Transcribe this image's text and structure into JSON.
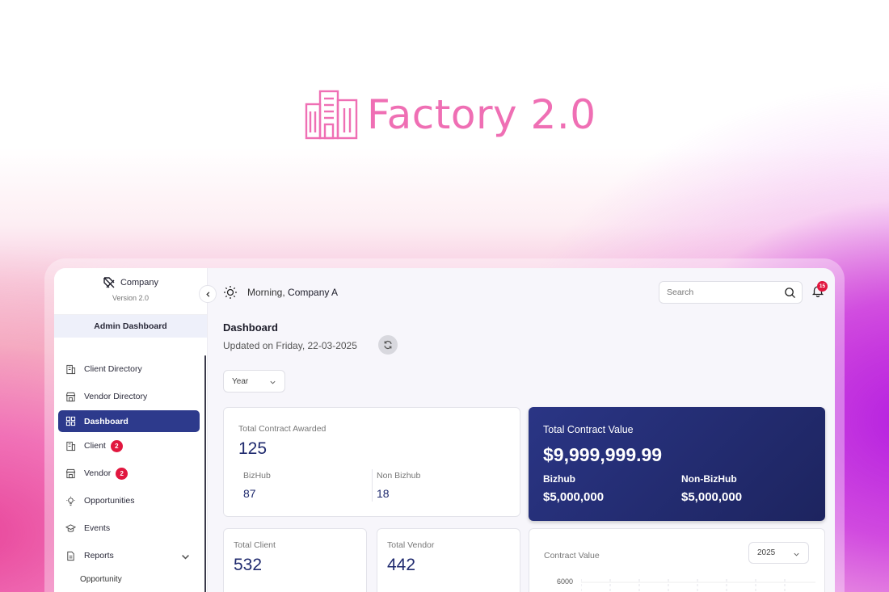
{
  "hero": {
    "title": "Factory 2.0",
    "color": "#ef6fb4"
  },
  "brand": {
    "name": "Company",
    "version": "Version 2.0"
  },
  "sidebar": {
    "section_label": "Admin Dashboard",
    "items": [
      {
        "label": "Client Directory",
        "icon": "building-icon"
      },
      {
        "label": "Vendor Directory",
        "icon": "store-icon"
      },
      {
        "label": "Dashboard",
        "icon": "grid-icon",
        "active": true
      },
      {
        "label": "Client",
        "icon": "building-icon",
        "badge": "2"
      },
      {
        "label": "Vendor",
        "icon": "store-icon",
        "badge": "2"
      },
      {
        "label": "Opportunities",
        "icon": "lightbulb-icon"
      },
      {
        "label": "Events",
        "icon": "graduation-cap-icon"
      },
      {
        "label": "Reports",
        "icon": "document-icon"
      }
    ],
    "sub_items": [
      {
        "label": "Opportunity"
      }
    ]
  },
  "header": {
    "greeting_prefix": "Morning,",
    "greeting_name": "Company A",
    "search_placeholder": "Search",
    "notification_count": "15"
  },
  "page": {
    "title": "Dashboard",
    "updated": "Updated on Friday, 22-03-2025",
    "period_filter": "Year"
  },
  "cards": {
    "awarded": {
      "label": "Total Contract Awarded",
      "value": "125",
      "bizhub_label": "BizHub",
      "bizhub_value": "87",
      "non_bizhub_label": "Non Bizhub",
      "non_bizhub_value": "18"
    },
    "contract_value": {
      "label": "Total Contract Value",
      "value": "$9,999,999.99",
      "bizhub_label": "Bizhub",
      "bizhub_value": "$5,000,000",
      "non_bizhub_label": "Non-BizHub",
      "non_bizhub_value": "$5,000,000",
      "color": "#2a3585"
    },
    "client": {
      "label": "Total Client",
      "value": "532"
    },
    "vendor": {
      "label": "Total Vendor",
      "value": "442"
    },
    "chart": {
      "label": "Contract Value",
      "year": "2025",
      "y_tick": "6000"
    }
  },
  "colors": {
    "accent": "#2d3a8c",
    "badge": "#e1173f"
  }
}
